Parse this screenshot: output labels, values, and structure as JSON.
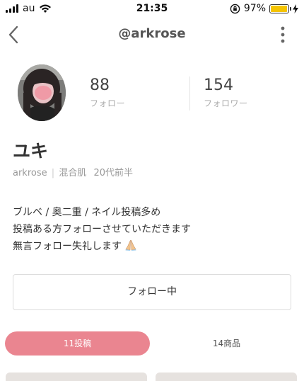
{
  "status_bar": {
    "carrier": "au",
    "time": "21:35",
    "battery_percent_label": "97%",
    "battery_level": 0.97,
    "battery_color": "#f5c400"
  },
  "nav": {
    "title": "@arkrose",
    "back_icon": "chevron-left-icon",
    "more_icon": "more-vertical-icon"
  },
  "profile": {
    "following_count": "88",
    "following_label": "フォロー",
    "followers_count": "154",
    "followers_label": "フォロワー",
    "name": "ユキ",
    "username": "arkrose",
    "separator": "|",
    "skin_type": "混合肌",
    "age": "20代前半",
    "bio_lines": [
      "ブルベ / 奥二重 / ネイル投稿多め",
      "投稿ある方フォローさせていただきます",
      "無言フォロー失礼します"
    ],
    "bio_emoji_icon": "folded-hands-icon"
  },
  "follow_button": {
    "label": "フォロー中"
  },
  "tabs": [
    {
      "label": "11投稿",
      "active": true,
      "color": "#ea8590"
    },
    {
      "label": "14商品",
      "active": false
    }
  ]
}
